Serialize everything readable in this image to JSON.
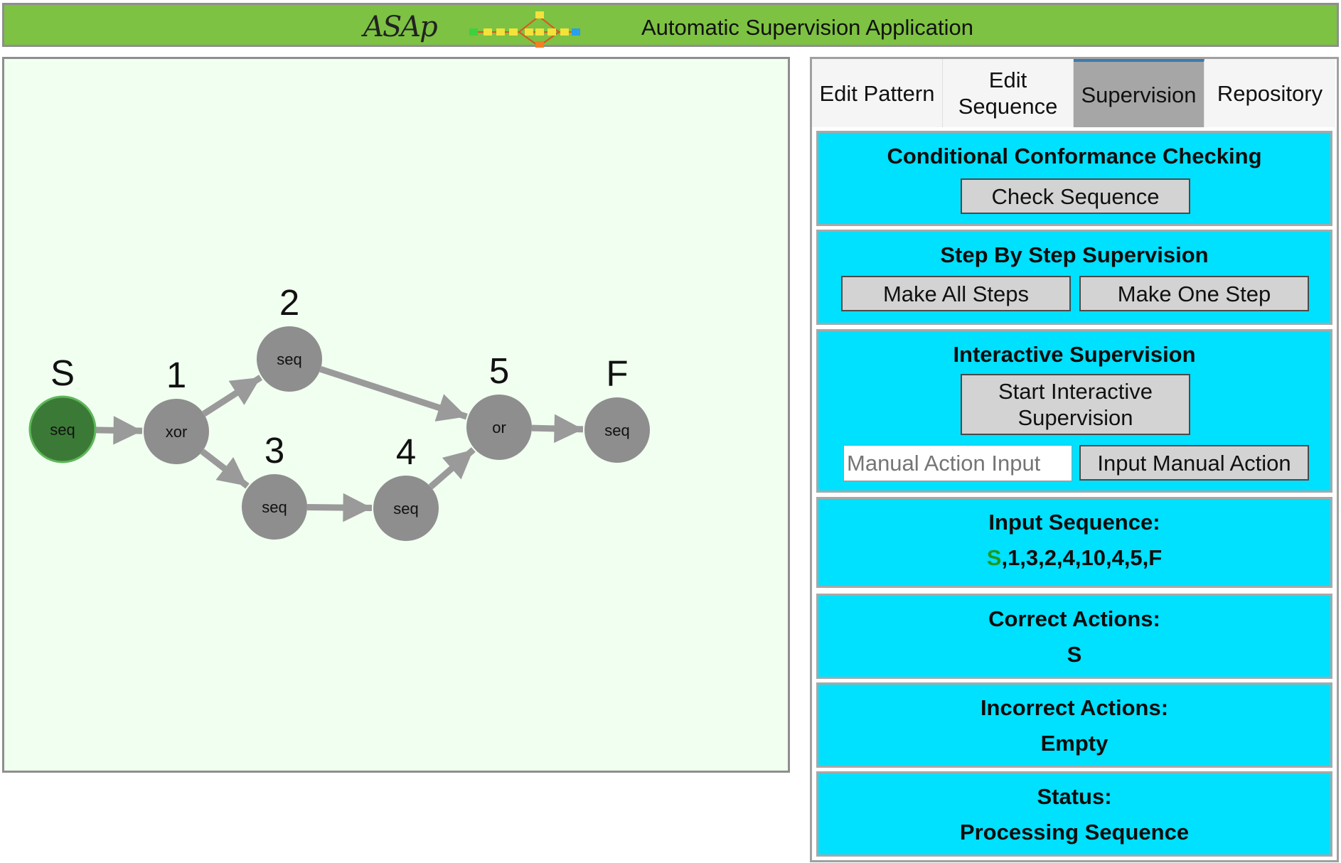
{
  "header": {
    "logo_text": "ASAp",
    "title": "Automatic Supervision Application"
  },
  "graph": {
    "nodes": [
      {
        "id": "S",
        "label": "S",
        "type": "seq",
        "state": "done"
      },
      {
        "id": "1",
        "label": "1",
        "type": "xor",
        "state": "pending"
      },
      {
        "id": "2",
        "label": "2",
        "type": "seq",
        "state": "pending"
      },
      {
        "id": "3",
        "label": "3",
        "type": "seq",
        "state": "pending"
      },
      {
        "id": "4",
        "label": "4",
        "type": "seq",
        "state": "pending"
      },
      {
        "id": "5",
        "label": "5",
        "type": "or",
        "state": "pending"
      },
      {
        "id": "F",
        "label": "F",
        "type": "seq",
        "state": "pending"
      }
    ],
    "edges": [
      [
        "S",
        "1"
      ],
      [
        "1",
        "2"
      ],
      [
        "1",
        "3"
      ],
      [
        "2",
        "5"
      ],
      [
        "3",
        "4"
      ],
      [
        "4",
        "5"
      ],
      [
        "5",
        "F"
      ]
    ],
    "colors": {
      "done": "#3b7a36",
      "pending": "#8e8e8e",
      "edge": "#9a9a9a"
    }
  },
  "tabs": [
    {
      "label": "Edit Pattern",
      "active": false
    },
    {
      "label": "Edit Sequence",
      "active": false
    },
    {
      "label": "Supervision",
      "active": true
    },
    {
      "label": "Repository",
      "active": false
    }
  ],
  "conformance": {
    "title": "Conditional Conformance Checking",
    "check_button": "Check Sequence"
  },
  "step_by_step": {
    "title": "Step By Step Supervision",
    "all_steps_button": "Make All Steps",
    "one_step_button": "Make One Step"
  },
  "interactive": {
    "title": "Interactive Supervision",
    "start_button": "Start Interactive Supervision",
    "manual_input_placeholder": "Manual Action Input",
    "manual_input_value": "",
    "input_button": "Input Manual Action"
  },
  "input_sequence": {
    "title": "Input Sequence:",
    "processed": "S",
    "remaining": ",1,3,2,4,10,4,5,F"
  },
  "correct_actions": {
    "title": "Correct Actions:",
    "value": "S"
  },
  "incorrect_actions": {
    "title": "Incorrect Actions:",
    "value": "Empty"
  },
  "status": {
    "title": "Status:",
    "value": "Processing Sequence"
  },
  "colors": {
    "header": "#7dc242",
    "canvas": "#f1fff0",
    "section": "#00e0ff",
    "accent_done": "#1f9a1f"
  }
}
